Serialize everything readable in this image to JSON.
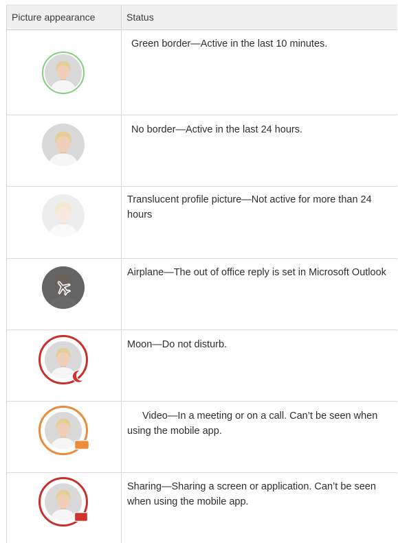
{
  "table": {
    "headers": {
      "appearance": "Picture appearance",
      "status": "Status"
    },
    "rows": [
      {
        "status": "Green border—Active in the last 10 minutes.",
        "style": "green-border",
        "border_color": "#7ed07a"
      },
      {
        "status": "No border—Active in the last 24 hours.",
        "style": "no-border"
      },
      {
        "status": "Translucent profile picture—Not active for more than 24 hours",
        "style": "translucent"
      },
      {
        "status": "Airplane—The out of office reply is set in Microsoft Outlook",
        "style": "airplane",
        "icon": "airplane-icon"
      },
      {
        "status": "Moon—Do not disturb.",
        "style": "moon",
        "border_color": "#c9302c",
        "icon": "moon-icon"
      },
      {
        "status": "Video—In a meeting or on a call. Can’t be seen when using the mobile app.",
        "style": "video",
        "border_color": "#ec8a3a",
        "icon": "video-camera-icon"
      },
      {
        "status": "Sharing—Sharing a screen or application. Can’t be seen when using the mobile app.",
        "style": "sharing",
        "border_color": "#c9302c",
        "icon": "screen-share-icon"
      }
    ]
  }
}
